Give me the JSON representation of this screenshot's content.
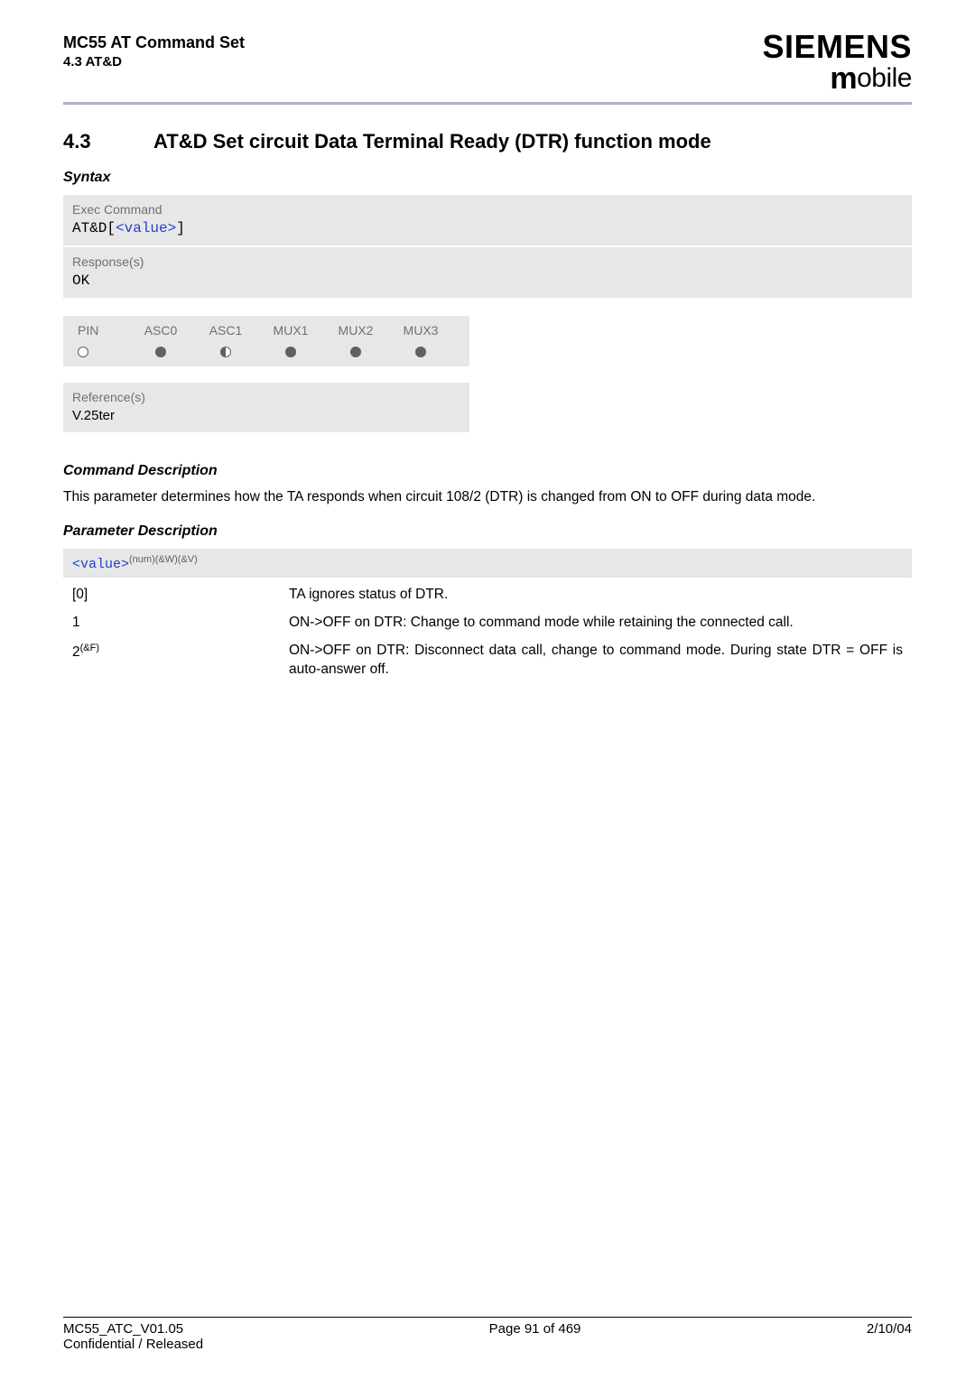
{
  "header": {
    "doc_title": "MC55 AT Command Set",
    "subsection": "4.3 AT&D",
    "brand": "SIEMENS",
    "brand_sub_m": "m",
    "brand_sub_rest": "obile"
  },
  "section": {
    "number": "4.3",
    "title": "AT&D   Set circuit Data Terminal Ready (DTR) function mode"
  },
  "syntax": {
    "heading": "Syntax",
    "exec_label": "Exec Command",
    "exec_cmd_prefix": "AT&D[",
    "exec_cmd_param": "<value>",
    "exec_cmd_suffix": "]",
    "response_label": "Response(s)",
    "response_value": "OK"
  },
  "support": {
    "cols": [
      "PIN",
      "ASC0",
      "ASC1",
      "MUX1",
      "MUX2",
      "MUX3"
    ],
    "states": [
      "open",
      "full",
      "half",
      "full",
      "full",
      "full"
    ]
  },
  "reference": {
    "label": "Reference(s)",
    "value": "V.25ter"
  },
  "cmd_desc": {
    "heading": "Command Description",
    "text": "This parameter determines how the TA responds when circuit 108/2 (DTR) is changed from ON to OFF during data mode."
  },
  "param_desc": {
    "heading": "Parameter Description",
    "header_left": "<value>",
    "header_sup": "(num)(&W)(&V)",
    "rows": [
      {
        "key": "[0]",
        "sup": "",
        "desc": "TA ignores status of DTR."
      },
      {
        "key": "1",
        "sup": "",
        "desc": "ON->OFF on DTR: Change to command mode while retaining the connected call."
      },
      {
        "key": "2",
        "sup": "(&F)",
        "desc": "ON->OFF on DTR: Disconnect data call, change to command mode. During state DTR = OFF is auto-answer off."
      }
    ]
  },
  "footer": {
    "left1": "MC55_ATC_V01.05",
    "left2": "Confidential / Released",
    "center": "Page 91 of 469",
    "right": "2/10/04"
  }
}
